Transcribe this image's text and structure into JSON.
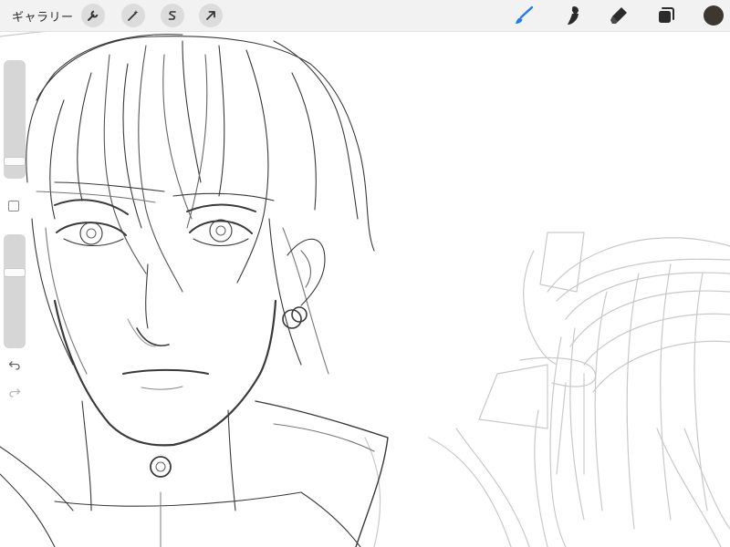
{
  "toolbar": {
    "gallery_label": "ギャラリー",
    "left_tools": [
      {
        "name": "actions",
        "icon": "wrench-icon"
      },
      {
        "name": "adjustments",
        "icon": "magic-wand-icon"
      },
      {
        "name": "selection",
        "icon": "selection-s-icon"
      },
      {
        "name": "transform",
        "icon": "transform-arrow-icon"
      }
    ],
    "right_tools": [
      {
        "name": "brush",
        "icon": "brush-icon",
        "active": true
      },
      {
        "name": "smudge",
        "icon": "smudge-icon",
        "active": false
      },
      {
        "name": "eraser",
        "icon": "eraser-icon",
        "active": false
      },
      {
        "name": "layers",
        "icon": "layers-icon",
        "active": false
      }
    ],
    "current_color": "#3d3732",
    "accent_color": "#1e7df0"
  },
  "sidebar": {
    "brush_size_level": 0.12,
    "opacity_level": 0.68,
    "undo_icon": "undo-icon",
    "redo_icon": "redo-icon",
    "modify_icon": "square-modify-icon"
  }
}
